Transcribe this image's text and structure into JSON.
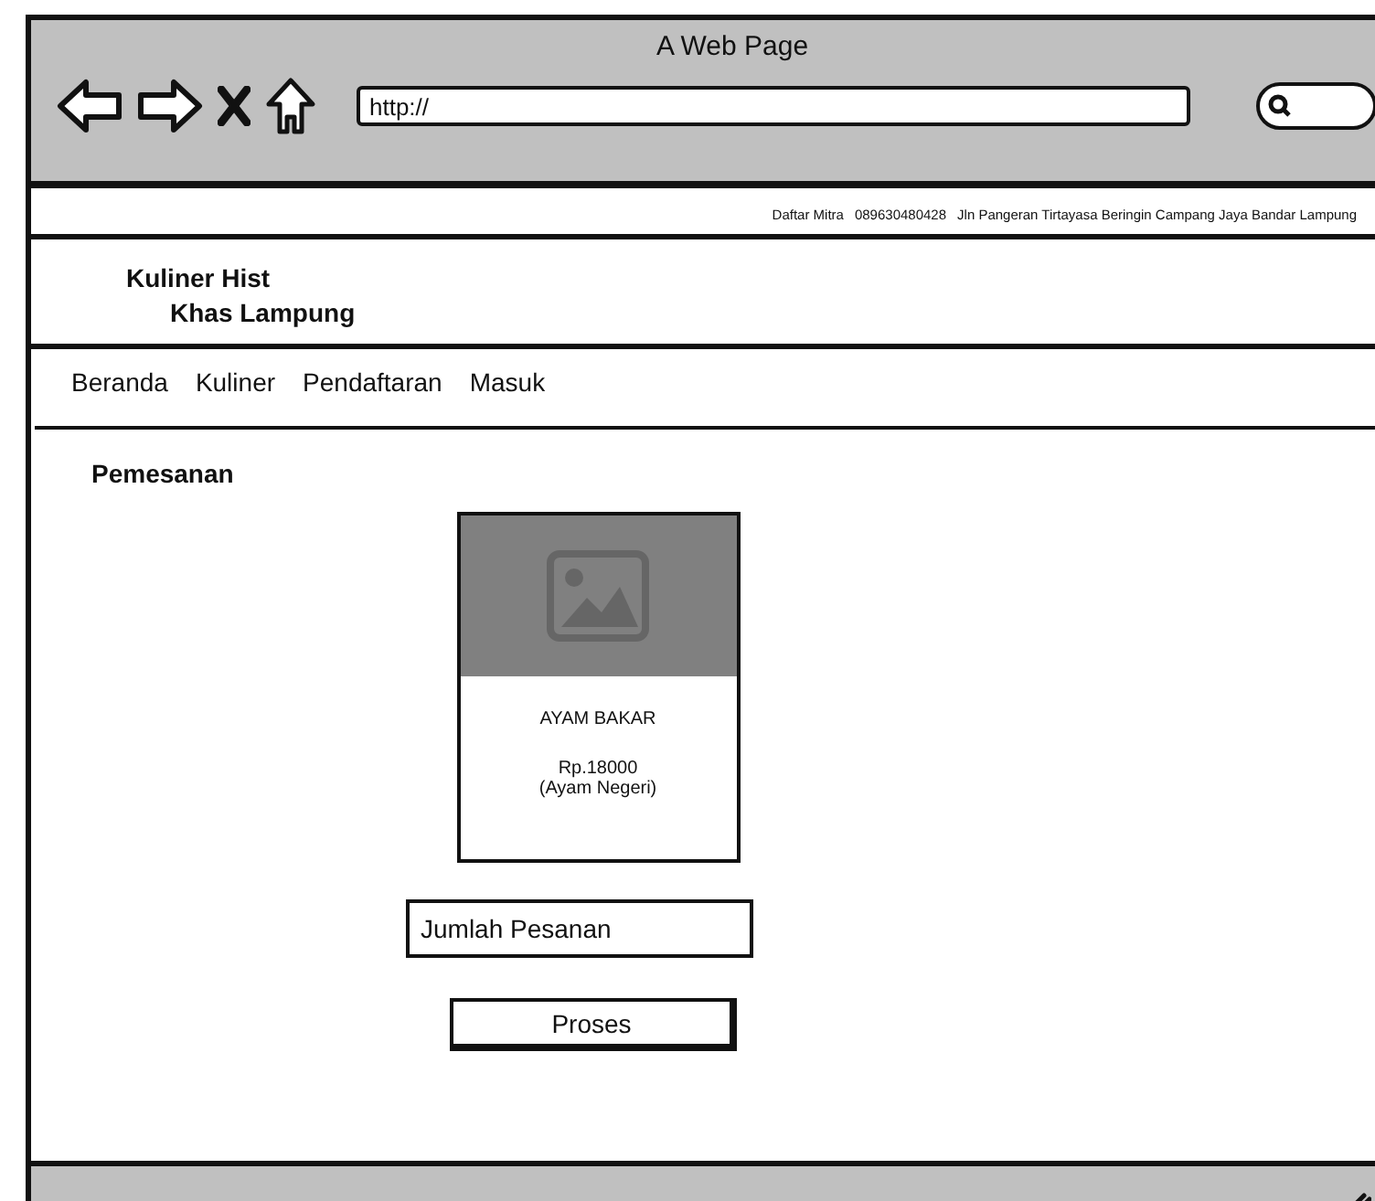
{
  "window": {
    "title": "A Web Page",
    "address": "http://"
  },
  "top_bar": [
    "Daftar Mitra",
    "089630480428",
    "Jln Pangeran Tirtayasa Beringin Campang Jaya Bandar Lampung"
  ],
  "brand": {
    "line_1": "Kuliner Hist",
    "line_2": "Khas Lampung"
  },
  "nav": [
    {
      "label": "Beranda"
    },
    {
      "label": "Kuliner"
    },
    {
      "label": "Pendaftaran"
    },
    {
      "label": "Masuk"
    }
  ],
  "heading": "Pemesanan",
  "product": {
    "name": "AYAM BAKAR",
    "price": "Rp.18000",
    "note": "(Ayam Negeri)"
  },
  "quantity_field": {
    "value": "Jumlah Pesanan"
  },
  "button": "Proses"
}
